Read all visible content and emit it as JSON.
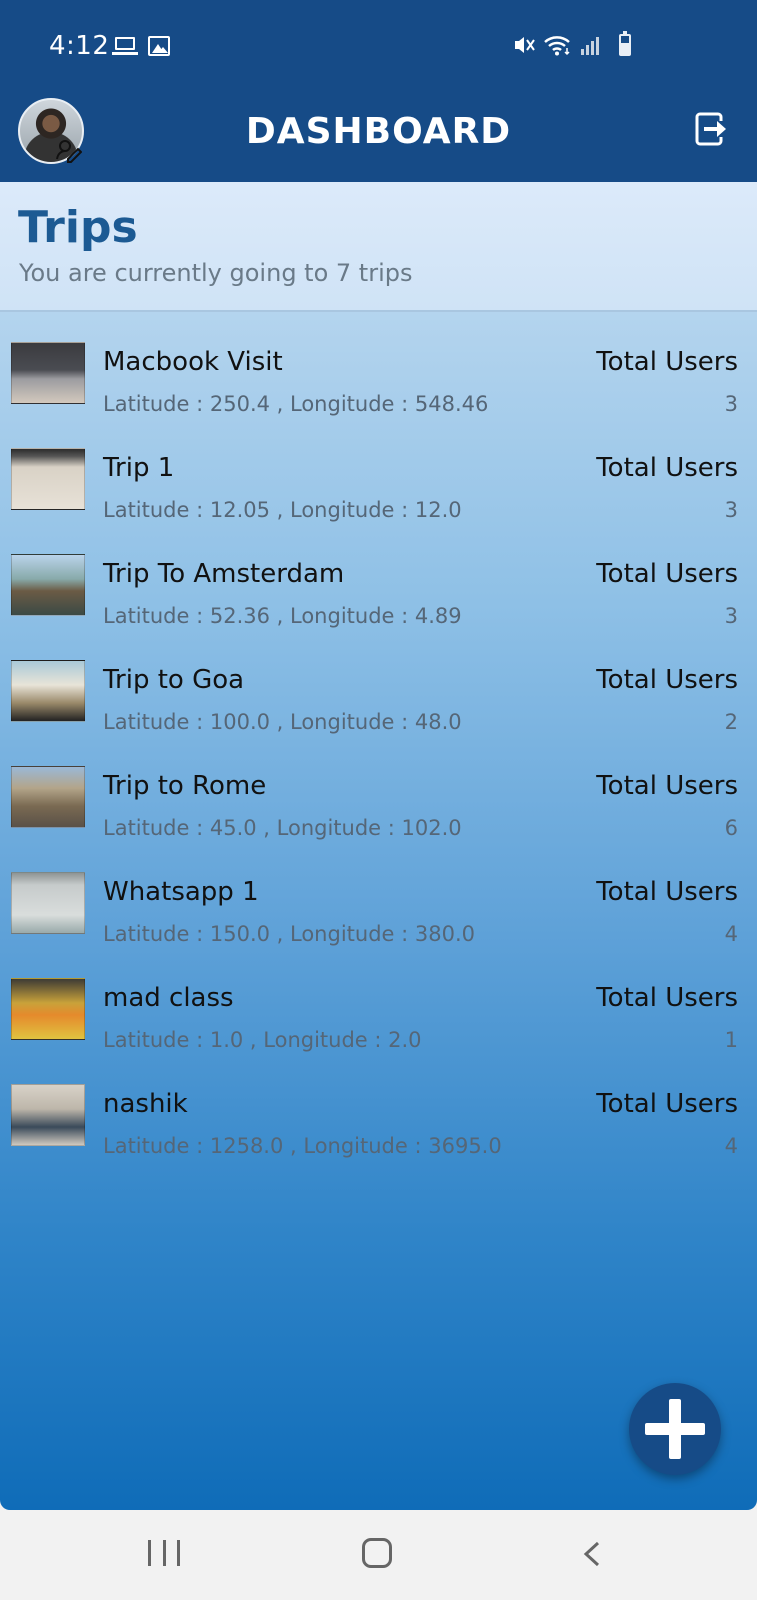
{
  "status_bar": {
    "time": "4:12",
    "left_icons": [
      "laptop-icon",
      "image-icon"
    ],
    "right_icons": [
      "mute-icon",
      "wifi-icon",
      "signal-icon",
      "battery-icon"
    ]
  },
  "toolbar": {
    "title": "DASHBOARD",
    "avatar_icon": "avatar",
    "logout_icon": "logout-icon"
  },
  "section": {
    "title": "Trips",
    "subtitle": "You are currently going to 7 trips"
  },
  "trips": [
    {
      "name": "Macbook Visit",
      "coords": "Latitude : 250.4  ,  Longitude : 548.46",
      "users_label": "Total Users",
      "users": "3"
    },
    {
      "name": "Trip 1",
      "coords": "Latitude : 12.05  ,  Longitude : 12.0",
      "users_label": "Total Users",
      "users": "3"
    },
    {
      "name": "Trip To Amsterdam",
      "coords": "Latitude : 52.36  ,  Longitude : 4.89",
      "users_label": "Total Users",
      "users": "3"
    },
    {
      "name": "Trip to Goa",
      "coords": "Latitude : 100.0  ,  Longitude : 48.0",
      "users_label": "Total Users",
      "users": "2"
    },
    {
      "name": "Trip to Rome",
      "coords": "Latitude : 45.0  ,  Longitude : 102.0",
      "users_label": "Total Users",
      "users": "6"
    },
    {
      "name": "Whatsapp 1",
      "coords": "Latitude : 150.0  ,  Longitude : 380.0",
      "users_label": "Total Users",
      "users": "4"
    },
    {
      "name": "mad class",
      "coords": "Latitude : 1.0  ,  Longitude : 2.0",
      "users_label": "Total Users",
      "users": "1"
    },
    {
      "name": "nashik",
      "coords": "Latitude : 1258.0  ,  Longitude : 3695.0",
      "users_label": "Total Users",
      "users": "4"
    }
  ],
  "fab": {
    "icon": "plus-icon"
  },
  "nav": {
    "icons": [
      "recents-icon",
      "home-icon",
      "back-icon"
    ]
  },
  "colors": {
    "primary": "#164b87",
    "title_blue": "#1c5a93",
    "fab": "#164b87"
  }
}
